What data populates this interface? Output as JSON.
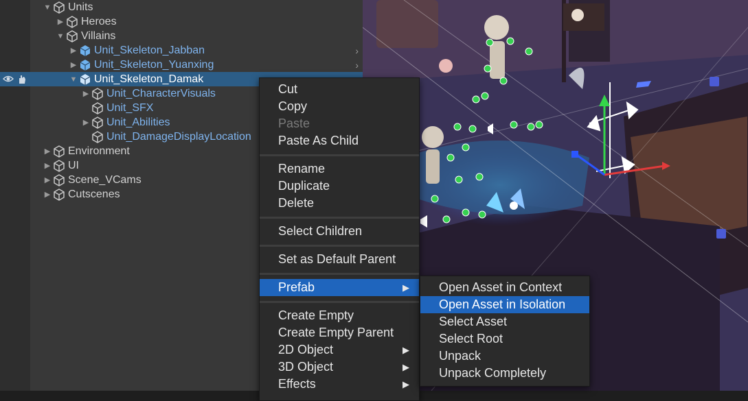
{
  "hierarchy": {
    "rows": [
      {
        "label": "Units",
        "prefab": false,
        "fold": "▼"
      },
      {
        "label": "Heroes",
        "prefab": false,
        "fold": "▶"
      },
      {
        "label": "Villains",
        "prefab": false,
        "fold": "▼"
      },
      {
        "label": "Unit_Skeleton_Jabban",
        "prefab": true,
        "fold": "▶"
      },
      {
        "label": "Unit_Skeleton_Yuanxing",
        "prefab": true,
        "fold": "▶"
      },
      {
        "label": "Unit_Skeleton_Damak",
        "prefab": true,
        "fold": "▼"
      },
      {
        "label": "Unit_CharacterVisuals",
        "prefab": true,
        "fold": "▶"
      },
      {
        "label": "Unit_SFX",
        "prefab": true,
        "fold": ""
      },
      {
        "label": "Unit_Abilities",
        "prefab": true,
        "fold": "▶"
      },
      {
        "label": "Unit_DamageDisplayLocation",
        "prefab": true,
        "fold": ""
      },
      {
        "label": "Environment",
        "prefab": false,
        "fold": "▶"
      },
      {
        "label": "UI",
        "prefab": false,
        "fold": "▶"
      },
      {
        "label": "Scene_VCams",
        "prefab": false,
        "fold": "▶"
      },
      {
        "label": "Cutscenes",
        "prefab": false,
        "fold": "▶"
      }
    ],
    "selected_index": 5
  },
  "context_menu": {
    "items": [
      {
        "label": "Cut"
      },
      {
        "label": "Copy"
      },
      {
        "label": "Paste",
        "disabled": true
      },
      {
        "label": "Paste As Child"
      },
      {
        "label": "Rename"
      },
      {
        "label": "Duplicate"
      },
      {
        "label": "Delete"
      },
      {
        "label": "Select Children"
      },
      {
        "label": "Set as Default Parent"
      },
      {
        "label": "Prefab",
        "submenu": true,
        "active": true
      },
      {
        "label": "Create Empty"
      },
      {
        "label": "Create Empty Parent"
      },
      {
        "label": "2D Object",
        "submenu": true
      },
      {
        "label": "3D Object",
        "submenu": true
      },
      {
        "label": "Effects",
        "submenu": true
      }
    ]
  },
  "prefab_submenu": {
    "items": [
      {
        "label": "Open Asset in Context"
      },
      {
        "label": "Open Asset in Isolation",
        "active": true
      },
      {
        "label": "Select Asset"
      },
      {
        "label": "Select Root"
      },
      {
        "label": "Unpack"
      },
      {
        "label": "Unpack Completely"
      }
    ]
  },
  "colors": {
    "panel": "#383838",
    "selection": "#2c5d87",
    "menu": "#2b2b2b",
    "menu_highlight": "#1f65bd",
    "prefab_text": "#7fb4ee"
  },
  "icons": {
    "eye": "eye-icon",
    "hand": "hand-icon",
    "gameobject": "gameobject-cube-icon",
    "prefab": "prefab-cube-icon",
    "submenu": "triangle-right-icon"
  }
}
